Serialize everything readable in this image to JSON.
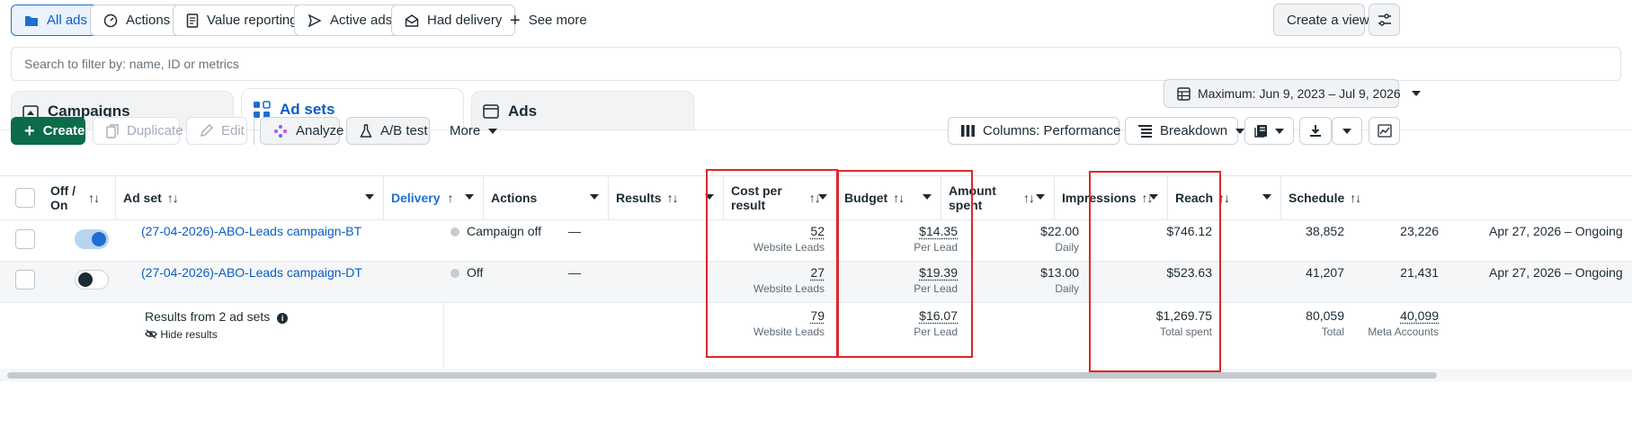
{
  "filter_bar": {
    "all_ads": "All ads",
    "actions": "Actions",
    "value_reporting": "Value reporting",
    "active_ads": "Active ads",
    "had_delivery": "Had delivery",
    "see_more": "See more",
    "create_view": "Create a view"
  },
  "search": {
    "placeholder": "Search to filter by: name, ID or metrics"
  },
  "tabs": {
    "campaigns": "Campaigns",
    "ad_sets": "Ad sets",
    "ads": "Ads"
  },
  "date_range": "Maximum: Jun 9, 2023 – Jul 9, 2026",
  "toolbar": {
    "create": "Create",
    "duplicate": "Duplicate",
    "edit": "Edit",
    "analyze": "Analyze",
    "ab_test": "A/B test",
    "more": "More",
    "columns": "Columns: Performance",
    "breakdown": "Breakdown"
  },
  "table": {
    "headers": {
      "off_on_1": "Off /",
      "off_on_2": "On",
      "ad_set": "Ad set",
      "delivery": "Delivery",
      "actions": "Actions",
      "results": "Results",
      "cost_1": "Cost per",
      "cost_2": "result",
      "budget": "Budget",
      "amount_1": "Amount",
      "amount_2": "spent",
      "impressions": "Impressions",
      "reach": "Reach",
      "schedule": "Schedule"
    },
    "rows": [
      {
        "name": "(27-04-2026)-ABO-Leads campaign-BT",
        "toggle": "on",
        "delivery": "Campaign off",
        "actions": "—",
        "results": "52",
        "results_sub": "Website Leads",
        "cost": "$14.35",
        "cost_sub": "Per Lead",
        "budget": "$22.00",
        "budget_sub": "Daily",
        "amount": "$746.12",
        "impressions": "38,852",
        "reach": "23,226",
        "schedule": "Apr 27, 2026 – Ongoing"
      },
      {
        "name": "(27-04-2026)-ABO-Leads campaign-DT",
        "toggle": "off",
        "delivery": "Off",
        "actions": "—",
        "results": "27",
        "results_sub": "Website Leads",
        "cost": "$19.39",
        "cost_sub": "Per Lead",
        "budget": "$13.00",
        "budget_sub": "Daily",
        "amount": "$523.63",
        "impressions": "41,207",
        "reach": "21,431",
        "schedule": "Apr 27, 2026 – Ongoing"
      }
    ],
    "totals": {
      "label": "Results from 2 ad sets",
      "hide": "Hide results",
      "results": "79",
      "results_sub": "Website Leads",
      "cost": "$16.07",
      "cost_sub": "Per Lead",
      "amount": "$1,269.75",
      "amount_sub": "Total spent",
      "impressions": "80,059",
      "impressions_sub": "Total",
      "reach": "40,099",
      "reach_sub": "Meta Accounts"
    }
  },
  "colors": {
    "accent": "#1d6fd1",
    "primary_button": "#0b6b4a",
    "highlight": "#e0262b"
  }
}
